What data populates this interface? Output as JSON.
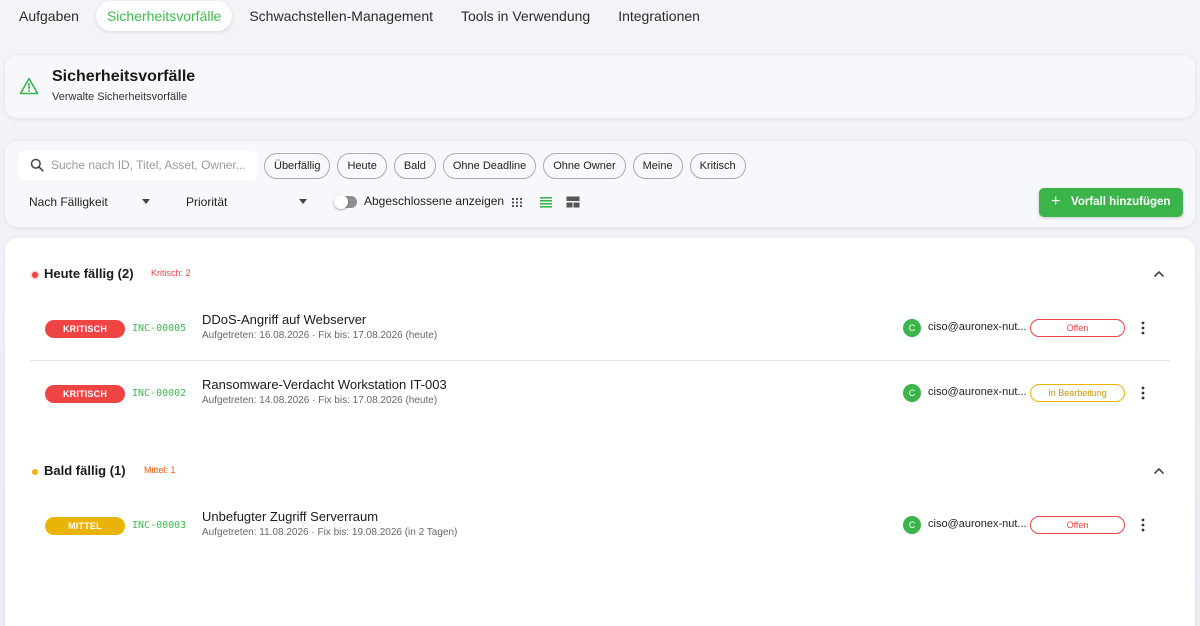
{
  "tabs": [
    {
      "label": "Aufgaben"
    },
    {
      "label": "Sicherheitsvorfälle"
    },
    {
      "label": "Schwachstellen-Management"
    },
    {
      "label": "Tools in Verwendung"
    },
    {
      "label": "Integrationen"
    }
  ],
  "header": {
    "title": "Sicherheitsvorfälle",
    "subtitle": "Verwalte Sicherheitsvorfälle",
    "icon": "warning-triangle-icon"
  },
  "filters": {
    "search_placeholder": "Suche nach ID, Titel, Asset, Owner...",
    "chips": [
      "Überfällig",
      "Heute",
      "Bald",
      "Ohne Deadline",
      "Ohne Owner",
      "Meine",
      "Kritisch"
    ],
    "sort_label": "Nach Fälligkeit",
    "priority_label": "Priorität",
    "toggle_label": "Abgeschlossene anzeigen",
    "add_button": "Vorfall hinzufügen"
  },
  "colors": {
    "accent": "#3bb54a",
    "critical": "#ef4444",
    "medium": "#eab308"
  },
  "groups": [
    {
      "title": "Heute fällig (2)",
      "count_label": "Kritisch: 2",
      "dot_color": "#ef4444",
      "items": [
        {
          "severity": "KRITISCH",
          "id": "INC-00005",
          "title": "DDoS-Angriff auf Webserver",
          "meta": "Aufgetreten: 16.08.2026 · Fix bis: 17.08.2026 (heute)",
          "avatar": "C",
          "owner": "ciso@auronex-nut...",
          "status": "Offen"
        },
        {
          "severity": "KRITISCH",
          "id": "INC-00002",
          "title": "Ransomware-Verdacht Workstation IT-003",
          "meta": "Aufgetreten: 14.08.2026 · Fix bis: 17.08.2026 (heute)",
          "avatar": "C",
          "owner": "ciso@auronex-nut...",
          "status": "In Bearbeitung"
        }
      ]
    },
    {
      "title": "Bald fällig (1)",
      "count_label": "Mittel: 1",
      "dot_color": "#eab308",
      "items": [
        {
          "severity": "MITTEL",
          "id": "INC-00003",
          "title": "Unbefugter Zugriff Serverraum",
          "meta": "Aufgetreten: 11.08.2026 · Fix bis: 19.08.2026 (in 2 Tagen)",
          "avatar": "C",
          "owner": "ciso@auronex-nut...",
          "status": "Offen"
        }
      ]
    }
  ]
}
